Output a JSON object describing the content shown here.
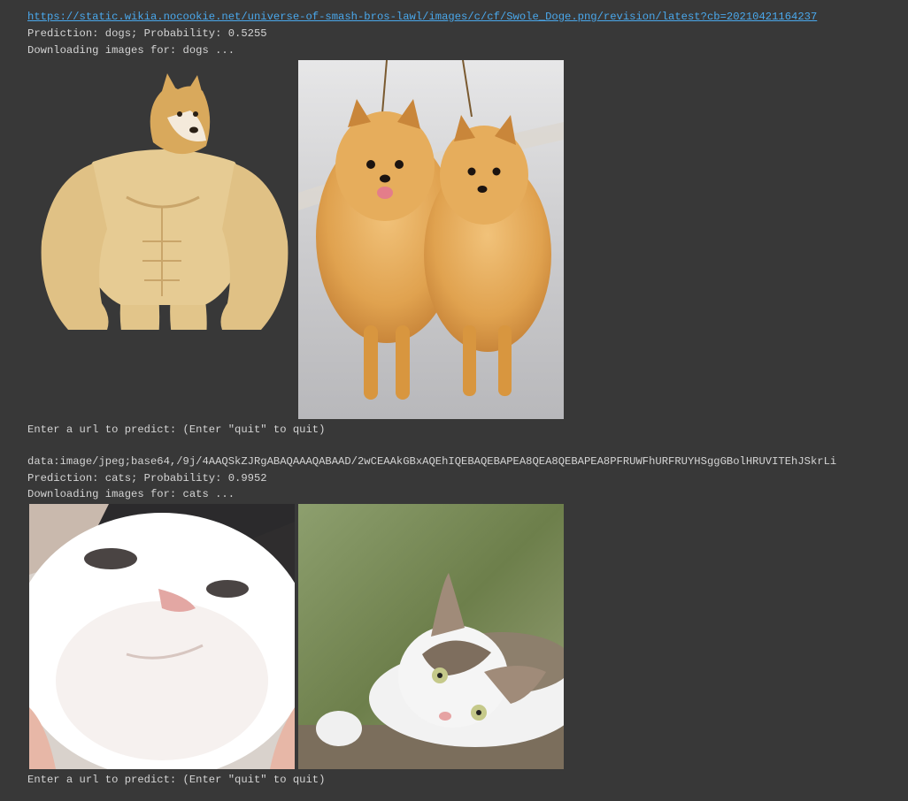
{
  "output": {
    "block1": {
      "url": "https://static.wikia.nocookie.net/universe-of-smash-bros-lawl/images/c/cf/Swole_Doge.png/revision/latest?cb=20210421164237",
      "prediction": "Prediction: dogs; Probability: 0.5255",
      "downloading": "Downloading images for: dogs ...",
      "images": [
        "swole-doge-meme",
        "two-pomeranian-dogs"
      ],
      "prompt": "Enter a url to predict: (Enter \"quit\" to quit)"
    },
    "block2": {
      "input": "data:image/jpeg;base64,/9j/4AAQSkZJRgABAQAAAQABAAD/2wCEAAkGBxAQEhIQEBAQEBAPEA8QEA8QEBAPEA8PFRUWFhURFRUYHSggGBolHRUVITEhJSkrLi",
      "prediction": "Prediction: cats; Probability: 0.9952",
      "downloading": "Downloading images for: cats ...",
      "images": [
        "white-cat-closeup",
        "tabby-white-cat-lying"
      ],
      "prompt": "Enter a url to predict: (Enter \"quit\" to quit)"
    }
  },
  "colors": {
    "background": "#383838",
    "text": "#d4d4d4",
    "link": "#4aa8ec"
  }
}
